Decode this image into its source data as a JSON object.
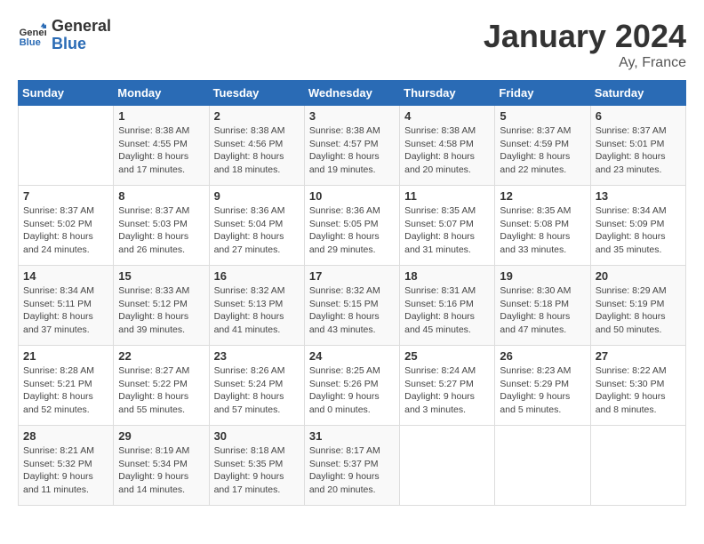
{
  "header": {
    "logo_general": "General",
    "logo_blue": "Blue",
    "month_title": "January 2024",
    "location": "Ay, France"
  },
  "weekdays": [
    "Sunday",
    "Monday",
    "Tuesday",
    "Wednesday",
    "Thursday",
    "Friday",
    "Saturday"
  ],
  "weeks": [
    [
      {
        "day": "",
        "info": ""
      },
      {
        "day": "1",
        "info": "Sunrise: 8:38 AM\nSunset: 4:55 PM\nDaylight: 8 hours\nand 17 minutes."
      },
      {
        "day": "2",
        "info": "Sunrise: 8:38 AM\nSunset: 4:56 PM\nDaylight: 8 hours\nand 18 minutes."
      },
      {
        "day": "3",
        "info": "Sunrise: 8:38 AM\nSunset: 4:57 PM\nDaylight: 8 hours\nand 19 minutes."
      },
      {
        "day": "4",
        "info": "Sunrise: 8:38 AM\nSunset: 4:58 PM\nDaylight: 8 hours\nand 20 minutes."
      },
      {
        "day": "5",
        "info": "Sunrise: 8:37 AM\nSunset: 4:59 PM\nDaylight: 8 hours\nand 22 minutes."
      },
      {
        "day": "6",
        "info": "Sunrise: 8:37 AM\nSunset: 5:01 PM\nDaylight: 8 hours\nand 23 minutes."
      }
    ],
    [
      {
        "day": "7",
        "info": "Sunrise: 8:37 AM\nSunset: 5:02 PM\nDaylight: 8 hours\nand 24 minutes."
      },
      {
        "day": "8",
        "info": "Sunrise: 8:37 AM\nSunset: 5:03 PM\nDaylight: 8 hours\nand 26 minutes."
      },
      {
        "day": "9",
        "info": "Sunrise: 8:36 AM\nSunset: 5:04 PM\nDaylight: 8 hours\nand 27 minutes."
      },
      {
        "day": "10",
        "info": "Sunrise: 8:36 AM\nSunset: 5:05 PM\nDaylight: 8 hours\nand 29 minutes."
      },
      {
        "day": "11",
        "info": "Sunrise: 8:35 AM\nSunset: 5:07 PM\nDaylight: 8 hours\nand 31 minutes."
      },
      {
        "day": "12",
        "info": "Sunrise: 8:35 AM\nSunset: 5:08 PM\nDaylight: 8 hours\nand 33 minutes."
      },
      {
        "day": "13",
        "info": "Sunrise: 8:34 AM\nSunset: 5:09 PM\nDaylight: 8 hours\nand 35 minutes."
      }
    ],
    [
      {
        "day": "14",
        "info": "Sunrise: 8:34 AM\nSunset: 5:11 PM\nDaylight: 8 hours\nand 37 minutes."
      },
      {
        "day": "15",
        "info": "Sunrise: 8:33 AM\nSunset: 5:12 PM\nDaylight: 8 hours\nand 39 minutes."
      },
      {
        "day": "16",
        "info": "Sunrise: 8:32 AM\nSunset: 5:13 PM\nDaylight: 8 hours\nand 41 minutes."
      },
      {
        "day": "17",
        "info": "Sunrise: 8:32 AM\nSunset: 5:15 PM\nDaylight: 8 hours\nand 43 minutes."
      },
      {
        "day": "18",
        "info": "Sunrise: 8:31 AM\nSunset: 5:16 PM\nDaylight: 8 hours\nand 45 minutes."
      },
      {
        "day": "19",
        "info": "Sunrise: 8:30 AM\nSunset: 5:18 PM\nDaylight: 8 hours\nand 47 minutes."
      },
      {
        "day": "20",
        "info": "Sunrise: 8:29 AM\nSunset: 5:19 PM\nDaylight: 8 hours\nand 50 minutes."
      }
    ],
    [
      {
        "day": "21",
        "info": "Sunrise: 8:28 AM\nSunset: 5:21 PM\nDaylight: 8 hours\nand 52 minutes."
      },
      {
        "day": "22",
        "info": "Sunrise: 8:27 AM\nSunset: 5:22 PM\nDaylight: 8 hours\nand 55 minutes."
      },
      {
        "day": "23",
        "info": "Sunrise: 8:26 AM\nSunset: 5:24 PM\nDaylight: 8 hours\nand 57 minutes."
      },
      {
        "day": "24",
        "info": "Sunrise: 8:25 AM\nSunset: 5:26 PM\nDaylight: 9 hours\nand 0 minutes."
      },
      {
        "day": "25",
        "info": "Sunrise: 8:24 AM\nSunset: 5:27 PM\nDaylight: 9 hours\nand 3 minutes."
      },
      {
        "day": "26",
        "info": "Sunrise: 8:23 AM\nSunset: 5:29 PM\nDaylight: 9 hours\nand 5 minutes."
      },
      {
        "day": "27",
        "info": "Sunrise: 8:22 AM\nSunset: 5:30 PM\nDaylight: 9 hours\nand 8 minutes."
      }
    ],
    [
      {
        "day": "28",
        "info": "Sunrise: 8:21 AM\nSunset: 5:32 PM\nDaylight: 9 hours\nand 11 minutes."
      },
      {
        "day": "29",
        "info": "Sunrise: 8:19 AM\nSunset: 5:34 PM\nDaylight: 9 hours\nand 14 minutes."
      },
      {
        "day": "30",
        "info": "Sunrise: 8:18 AM\nSunset: 5:35 PM\nDaylight: 9 hours\nand 17 minutes."
      },
      {
        "day": "31",
        "info": "Sunrise: 8:17 AM\nSunset: 5:37 PM\nDaylight: 9 hours\nand 20 minutes."
      },
      {
        "day": "",
        "info": ""
      },
      {
        "day": "",
        "info": ""
      },
      {
        "day": "",
        "info": ""
      }
    ]
  ]
}
